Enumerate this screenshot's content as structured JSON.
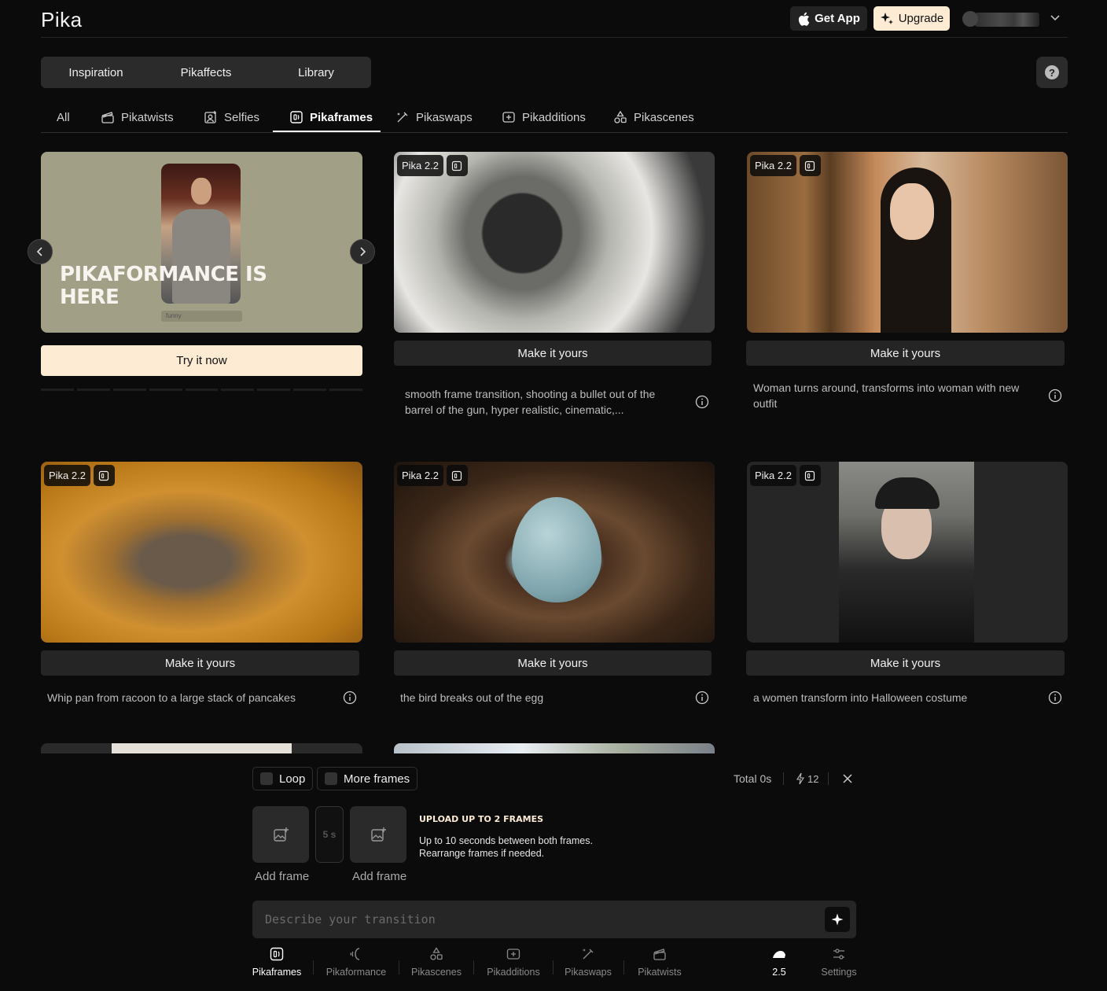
{
  "header": {
    "logo": "Pika",
    "get_app": "Get App",
    "upgrade": "Upgrade"
  },
  "main_tabs": [
    "Inspiration",
    "Pikaffects",
    "Library"
  ],
  "filters": [
    "All",
    "Pikatwists",
    "Selfies",
    "Pikaframes",
    "Pikaswaps",
    "Pikadditions",
    "Pikascenes"
  ],
  "active_filter": "Pikaframes",
  "promo": {
    "title": "PIKAFORMANCE IS HERE",
    "tag": "funny",
    "cta": "Try it now"
  },
  "cards": [
    {
      "badge": "Pika 2.2",
      "button": "Make it yours",
      "description": "smooth frame transition, shooting a bullet out of the barrel of the gun, hyper realistic, cinematic,..."
    },
    {
      "badge": "Pika 2.2",
      "button": "Make it yours",
      "description": "Woman turns around, transforms into woman with new outfit"
    },
    {
      "badge": "Pika 2.2",
      "button": "Make it yours",
      "description": "Whip pan from racoon to a large stack of pancakes"
    },
    {
      "badge": "Pika 2.2",
      "button": "Make it yours",
      "description": "the bird breaks out of the egg"
    },
    {
      "badge": "Pika 2.2",
      "button": "Make it yours",
      "description": "a women transform into Halloween costume"
    }
  ],
  "panel": {
    "loop": "Loop",
    "more_frames": "More frames",
    "total": "Total 0s",
    "credits": "12",
    "duration": "5 s",
    "add_frame": "Add frame",
    "upload_title": "UPLOAD UP TO 2 FRAMES",
    "upload_line1": "Up to 10 seconds between both frames.",
    "upload_line2": "Rearrange frames if needed.",
    "prompt_placeholder": "Describe your transition"
  },
  "toolbar": [
    "Pikaframes",
    "Pikaformance",
    "Pikascenes",
    "Pikadditions",
    "Pikaswaps",
    "Pikatwists",
    "2.5",
    "Settings"
  ],
  "colors": {
    "accent": "#fdebd3",
    "background": "#0b0b0b",
    "surface": "#252525"
  }
}
